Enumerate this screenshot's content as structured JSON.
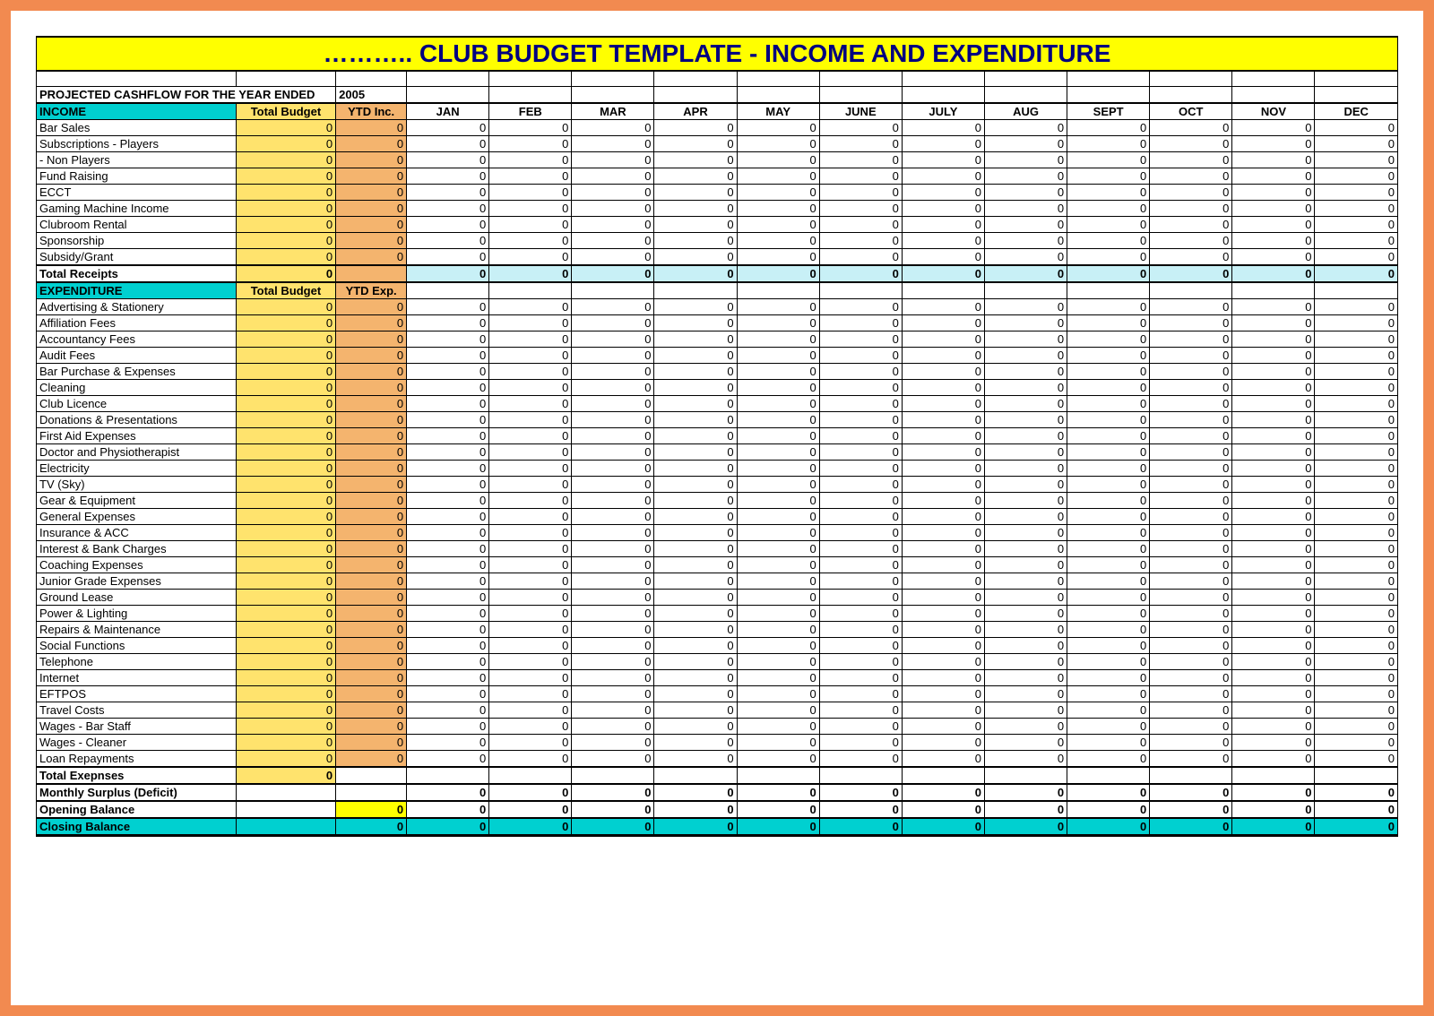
{
  "title": "………..  CLUB BUDGET TEMPLATE - INCOME AND EXPENDITURE",
  "projected_label": "PROJECTED CASHFLOW FOR THE YEAR ENDED",
  "projected_year": "2005",
  "columns": {
    "total_budget": "Total Budget",
    "ytd_inc": "YTD Inc.",
    "ytd_exp": "YTD Exp.",
    "months": [
      "JAN",
      "FEB",
      "MAR",
      "APR",
      "MAY",
      "JUNE",
      "JULY",
      "AUG",
      "SEPT",
      "OCT",
      "NOV",
      "DEC"
    ]
  },
  "sections": {
    "income": {
      "label": "INCOME",
      "rows": [
        {
          "label": "Bar Sales",
          "tb": "0",
          "ytd": "0",
          "m": [
            "0",
            "0",
            "0",
            "0",
            "0",
            "0",
            "0",
            "0",
            "0",
            "0",
            "0",
            "0"
          ]
        },
        {
          "label": "Subscriptions - Players",
          "tb": "0",
          "ytd": "0",
          "m": [
            "0",
            "0",
            "0",
            "0",
            "0",
            "0",
            "0",
            "0",
            "0",
            "0",
            "0",
            "0"
          ]
        },
        {
          "label": "               - Non Players",
          "tb": "0",
          "ytd": "0",
          "m": [
            "0",
            "0",
            "0",
            "0",
            "0",
            "0",
            "0",
            "0",
            "0",
            "0",
            "0",
            "0"
          ]
        },
        {
          "label": "Fund Raising",
          "tb": "0",
          "ytd": "0",
          "m": [
            "0",
            "0",
            "0",
            "0",
            "0",
            "0",
            "0",
            "0",
            "0",
            "0",
            "0",
            "0"
          ]
        },
        {
          "label": "ECCT",
          "tb": "0",
          "ytd": "0",
          "m": [
            "0",
            "0",
            "0",
            "0",
            "0",
            "0",
            "0",
            "0",
            "0",
            "0",
            "0",
            "0"
          ]
        },
        {
          "label": "Gaming Machine Income",
          "tb": "0",
          "ytd": "0",
          "m": [
            "0",
            "0",
            "0",
            "0",
            "0",
            "0",
            "0",
            "0",
            "0",
            "0",
            "0",
            "0"
          ]
        },
        {
          "label": "Clubroom Rental",
          "tb": "0",
          "ytd": "0",
          "m": [
            "0",
            "0",
            "0",
            "0",
            "0",
            "0",
            "0",
            "0",
            "0",
            "0",
            "0",
            "0"
          ]
        },
        {
          "label": "Sponsorship",
          "tb": "0",
          "ytd": "0",
          "m": [
            "0",
            "0",
            "0",
            "0",
            "0",
            "0",
            "0",
            "0",
            "0",
            "0",
            "0",
            "0"
          ]
        },
        {
          "label": "Subsidy/Grant",
          "tb": "0",
          "ytd": "0",
          "m": [
            "0",
            "0",
            "0",
            "0",
            "0",
            "0",
            "0",
            "0",
            "0",
            "0",
            "0",
            "0"
          ]
        }
      ],
      "total": {
        "label": "Total Receipts",
        "tb": "0",
        "ytd": "",
        "m": [
          "0",
          "0",
          "0",
          "0",
          "0",
          "0",
          "0",
          "0",
          "0",
          "0",
          "0",
          "0"
        ]
      }
    },
    "expenditure": {
      "label": "EXPENDITURE",
      "rows": [
        {
          "label": "Advertising & Stationery",
          "tb": "0",
          "ytd": "0",
          "m": [
            "0",
            "0",
            "0",
            "0",
            "0",
            "0",
            "0",
            "0",
            "0",
            "0",
            "0",
            "0"
          ]
        },
        {
          "label": "Affiliation Fees",
          "tb": "0",
          "ytd": "0",
          "m": [
            "0",
            "0",
            "0",
            "0",
            "0",
            "0",
            "0",
            "0",
            "0",
            "0",
            "0",
            "0"
          ]
        },
        {
          "label": "Accountancy Fees",
          "tb": "0",
          "ytd": "0",
          "m": [
            "0",
            "0",
            "0",
            "0",
            "0",
            "0",
            "0",
            "0",
            "0",
            "0",
            "0",
            "0"
          ]
        },
        {
          "label": "Audit Fees",
          "tb": "0",
          "ytd": "0",
          "m": [
            "0",
            "0",
            "0",
            "0",
            "0",
            "0",
            "0",
            "0",
            "0",
            "0",
            "0",
            "0"
          ]
        },
        {
          "label": "Bar Purchase & Expenses",
          "tb": "0",
          "ytd": "0",
          "m": [
            "0",
            "0",
            "0",
            "0",
            "0",
            "0",
            "0",
            "0",
            "0",
            "0",
            "0",
            "0"
          ]
        },
        {
          "label": "Cleaning",
          "tb": "0",
          "ytd": "0",
          "m": [
            "0",
            "0",
            "0",
            "0",
            "0",
            "0",
            "0",
            "0",
            "0",
            "0",
            "0",
            "0"
          ]
        },
        {
          "label": "Club Licence",
          "tb": "0",
          "ytd": "0",
          "m": [
            "0",
            "0",
            "0",
            "0",
            "0",
            "0",
            "0",
            "0",
            "0",
            "0",
            "0",
            "0"
          ]
        },
        {
          "label": "Donations & Presentations",
          "tb": "0",
          "ytd": "0",
          "m": [
            "0",
            "0",
            "0",
            "0",
            "0",
            "0",
            "0",
            "0",
            "0",
            "0",
            "0",
            "0"
          ]
        },
        {
          "label": "First Aid Expenses",
          "tb": "0",
          "ytd": "0",
          "m": [
            "0",
            "0",
            "0",
            "0",
            "0",
            "0",
            "0",
            "0",
            "0",
            "0",
            "0",
            "0"
          ]
        },
        {
          "label": "Doctor and Physiotherapist",
          "tb": "0",
          "ytd": "0",
          "m": [
            "0",
            "0",
            "0",
            "0",
            "0",
            "0",
            "0",
            "0",
            "0",
            "0",
            "0",
            "0"
          ]
        },
        {
          "label": "Electricity",
          "tb": "0",
          "ytd": "0",
          "m": [
            "0",
            "0",
            "0",
            "0",
            "0",
            "0",
            "0",
            "0",
            "0",
            "0",
            "0",
            "0"
          ]
        },
        {
          "label": "TV (Sky)",
          "tb": "0",
          "ytd": "0",
          "m": [
            "0",
            "0",
            "0",
            "0",
            "0",
            "0",
            "0",
            "0",
            "0",
            "0",
            "0",
            "0"
          ]
        },
        {
          "label": "Gear & Equipment",
          "tb": "0",
          "ytd": "0",
          "m": [
            "0",
            "0",
            "0",
            "0",
            "0",
            "0",
            "0",
            "0",
            "0",
            "0",
            "0",
            "0"
          ]
        },
        {
          "label": "General Expenses",
          "tb": "0",
          "ytd": "0",
          "m": [
            "0",
            "0",
            "0",
            "0",
            "0",
            "0",
            "0",
            "0",
            "0",
            "0",
            "0",
            "0"
          ]
        },
        {
          "label": "Insurance & ACC",
          "tb": "0",
          "ytd": "0",
          "m": [
            "0",
            "0",
            "0",
            "0",
            "0",
            "0",
            "0",
            "0",
            "0",
            "0",
            "0",
            "0"
          ]
        },
        {
          "label": "Interest & Bank Charges",
          "tb": "0",
          "ytd": "0",
          "m": [
            "0",
            "0",
            "0",
            "0",
            "0",
            "0",
            "0",
            "0",
            "0",
            "0",
            "0",
            "0"
          ]
        },
        {
          "label": "Coaching Expenses",
          "tb": "0",
          "ytd": "0",
          "m": [
            "0",
            "0",
            "0",
            "0",
            "0",
            "0",
            "0",
            "0",
            "0",
            "0",
            "0",
            "0"
          ]
        },
        {
          "label": "Junior Grade Expenses",
          "tb": "0",
          "ytd": "0",
          "m": [
            "0",
            "0",
            "0",
            "0",
            "0",
            "0",
            "0",
            "0",
            "0",
            "0",
            "0",
            "0"
          ]
        },
        {
          "label": "Ground Lease",
          "tb": "0",
          "ytd": "0",
          "m": [
            "0",
            "0",
            "0",
            "0",
            "0",
            "0",
            "0",
            "0",
            "0",
            "0",
            "0",
            "0"
          ]
        },
        {
          "label": "Power & Lighting",
          "tb": "0",
          "ytd": "0",
          "m": [
            "0",
            "0",
            "0",
            "0",
            "0",
            "0",
            "0",
            "0",
            "0",
            "0",
            "0",
            "0"
          ]
        },
        {
          "label": "Repairs & Maintenance",
          "tb": "0",
          "ytd": "0",
          "m": [
            "0",
            "0",
            "0",
            "0",
            "0",
            "0",
            "0",
            "0",
            "0",
            "0",
            "0",
            "0"
          ]
        },
        {
          "label": "Social Functions",
          "tb": "0",
          "ytd": "0",
          "m": [
            "0",
            "0",
            "0",
            "0",
            "0",
            "0",
            "0",
            "0",
            "0",
            "0",
            "0",
            "0"
          ]
        },
        {
          "label": "Telephone",
          "tb": "0",
          "ytd": "0",
          "m": [
            "0",
            "0",
            "0",
            "0",
            "0",
            "0",
            "0",
            "0",
            "0",
            "0",
            "0",
            "0"
          ]
        },
        {
          "label": "Internet",
          "tb": "0",
          "ytd": "0",
          "m": [
            "0",
            "0",
            "0",
            "0",
            "0",
            "0",
            "0",
            "0",
            "0",
            "0",
            "0",
            "0"
          ]
        },
        {
          "label": "EFTPOS",
          "tb": "0",
          "ytd": "0",
          "m": [
            "0",
            "0",
            "0",
            "0",
            "0",
            "0",
            "0",
            "0",
            "0",
            "0",
            "0",
            "0"
          ]
        },
        {
          "label": "Travel Costs",
          "tb": "0",
          "ytd": "0",
          "m": [
            "0",
            "0",
            "0",
            "0",
            "0",
            "0",
            "0",
            "0",
            "0",
            "0",
            "0",
            "0"
          ]
        },
        {
          "label": "Wages - Bar Staff",
          "tb": "0",
          "ytd": "0",
          "m": [
            "0",
            "0",
            "0",
            "0",
            "0",
            "0",
            "0",
            "0",
            "0",
            "0",
            "0",
            "0"
          ]
        },
        {
          "label": "Wages - Cleaner",
          "tb": "0",
          "ytd": "0",
          "m": [
            "0",
            "0",
            "0",
            "0",
            "0",
            "0",
            "0",
            "0",
            "0",
            "0",
            "0",
            "0"
          ]
        },
        {
          "label": "Loan Repayments",
          "tb": "0",
          "ytd": "0",
          "m": [
            "0",
            "0",
            "0",
            "0",
            "0",
            "0",
            "0",
            "0",
            "0",
            "0",
            "0",
            "0"
          ]
        }
      ],
      "total": {
        "label": "Total  Exepnses",
        "tb": "0",
        "ytd": "",
        "m": [
          "",
          "",
          "",
          "",
          "",
          "",
          "",
          "",
          "",
          "",
          "",
          ""
        ]
      }
    }
  },
  "surplus": {
    "label": "Monthly Surplus (Deficit)",
    "tb": "",
    "ytd": "",
    "m": [
      "0",
      "0",
      "0",
      "0",
      "0",
      "0",
      "0",
      "0",
      "0",
      "0",
      "0",
      "0"
    ]
  },
  "opening": {
    "label": "Opening Balance",
    "tb": "",
    "ytd": "0",
    "m": [
      "0",
      "0",
      "0",
      "0",
      "0",
      "0",
      "0",
      "0",
      "0",
      "0",
      "0",
      "0"
    ]
  },
  "closing": {
    "label": "Closing Balance",
    "tb": "",
    "ytd": "0",
    "m": [
      "0",
      "0",
      "0",
      "0",
      "0",
      "0",
      "0",
      "0",
      "0",
      "0",
      "0",
      "0"
    ]
  }
}
